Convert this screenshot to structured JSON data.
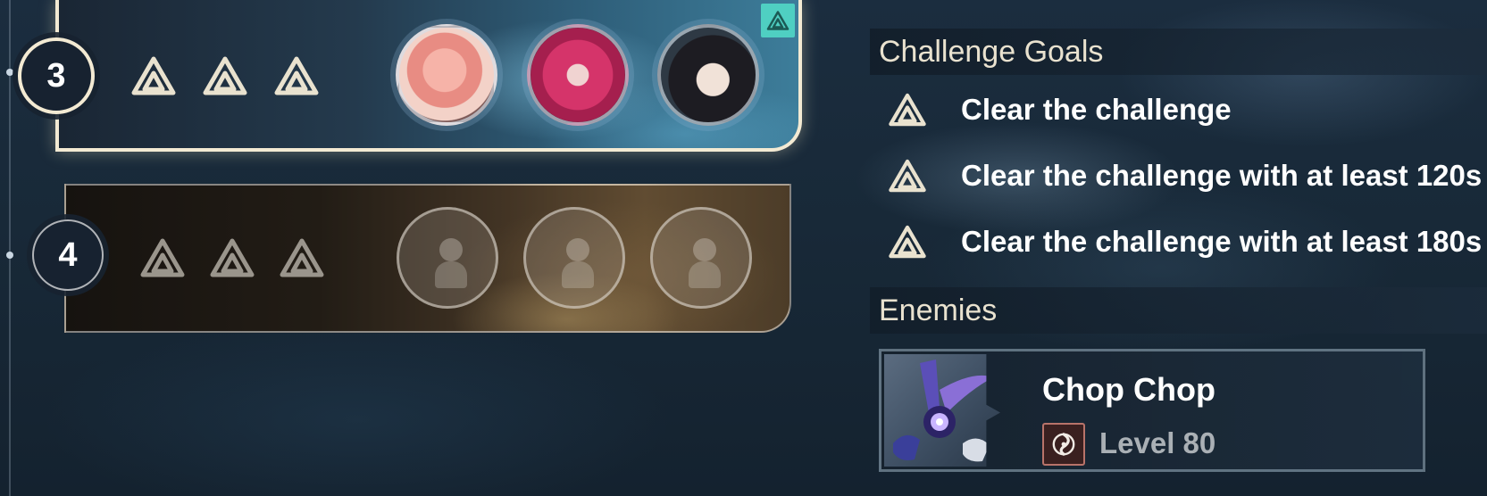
{
  "stages": [
    {
      "number": "3",
      "state": "selected",
      "runes_earned": 3,
      "team": [
        {
          "name": "pink-hair-character",
          "filled": true
        },
        {
          "name": "magenta-hair-character",
          "filled": true
        },
        {
          "name": "dark-hair-character",
          "filled": true
        }
      ]
    },
    {
      "number": "4",
      "state": "locked",
      "runes_earned": 0,
      "team": [
        {
          "name": "empty-slot",
          "filled": false
        },
        {
          "name": "empty-slot",
          "filled": false
        },
        {
          "name": "empty-slot",
          "filled": false
        }
      ]
    }
  ],
  "goals": {
    "title": "Challenge Goals",
    "items": [
      "Clear the challenge",
      "Clear the challenge with at least 120s",
      "Clear the challenge with at least 180s"
    ]
  },
  "enemies": {
    "title": "Enemies",
    "list": [
      {
        "name": "Chop Chop",
        "level": "Level 80",
        "element_icon": "havoc-element-icon"
      }
    ]
  },
  "colors": {
    "rune_active": "#e9e2cf",
    "rune_inactive": "#9a958c",
    "accent_teal": "#4fcfc2",
    "selected_border": "#f3ead3"
  }
}
